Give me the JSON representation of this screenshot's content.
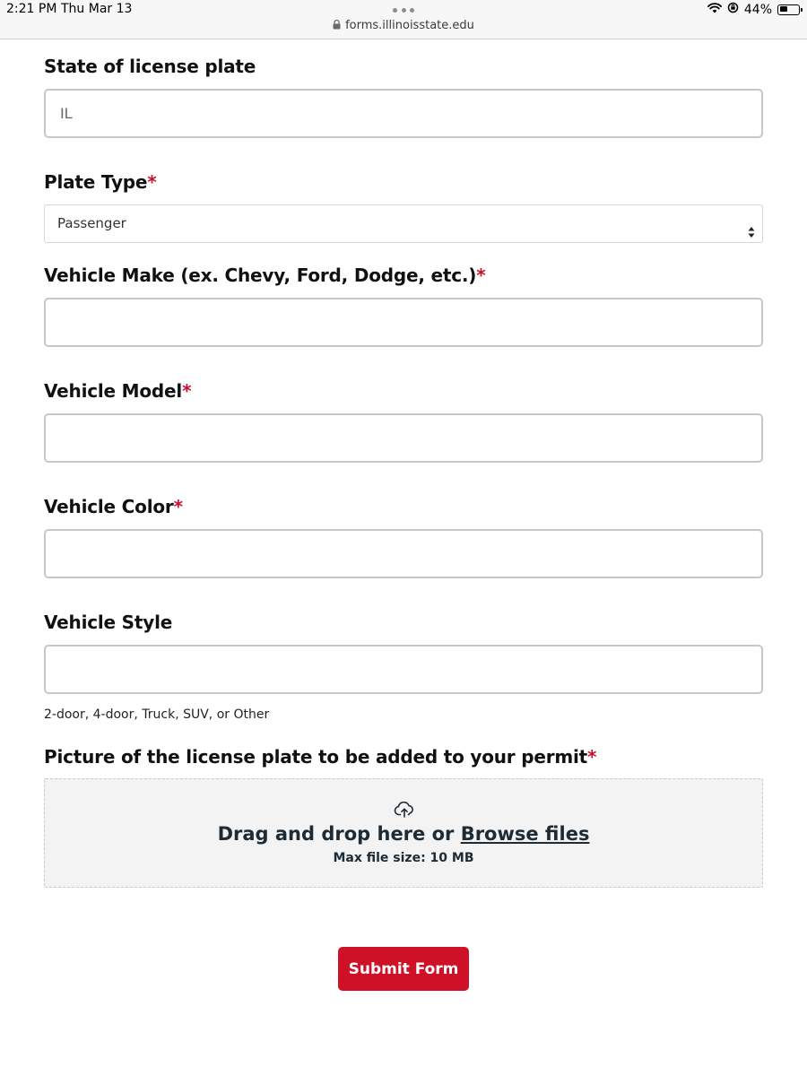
{
  "status_bar": {
    "time": "2:21 PM",
    "date": "Thu Mar 13",
    "url": "forms.illinoisstate.edu",
    "battery_percent": "44%",
    "battery_level": 0.44
  },
  "form": {
    "required_marker": "*",
    "state_of_plate": {
      "label": "State of license plate",
      "value": "IL"
    },
    "plate_type": {
      "label": "Plate Type",
      "selected": "Passenger"
    },
    "vehicle_make": {
      "label": "Vehicle Make (ex. Chevy, Ford, Dodge, etc.)",
      "value": ""
    },
    "vehicle_model": {
      "label": "Vehicle Model",
      "value": ""
    },
    "vehicle_color": {
      "label": "Vehicle Color",
      "value": ""
    },
    "vehicle_style": {
      "label": "Vehicle Style",
      "value": "",
      "hint": "2-door, 4-door, Truck, SUV, or Other"
    },
    "plate_picture": {
      "label": "Picture of the license plate to be added to your permit",
      "drop_text": "Drag and drop here or",
      "browse_text": "Browse files",
      "max_size": "Max file size: 10 MB"
    },
    "submit_label": "Submit Form"
  },
  "colors": {
    "required": "#c8102e",
    "submit_bg": "#ce1126",
    "dropzone_bg": "#f3f3f3"
  },
  "icons": [
    "lock-icon",
    "wifi-icon",
    "orientation-lock-icon",
    "battery-icon",
    "select-arrows-icon",
    "cloud-upload-icon"
  ]
}
